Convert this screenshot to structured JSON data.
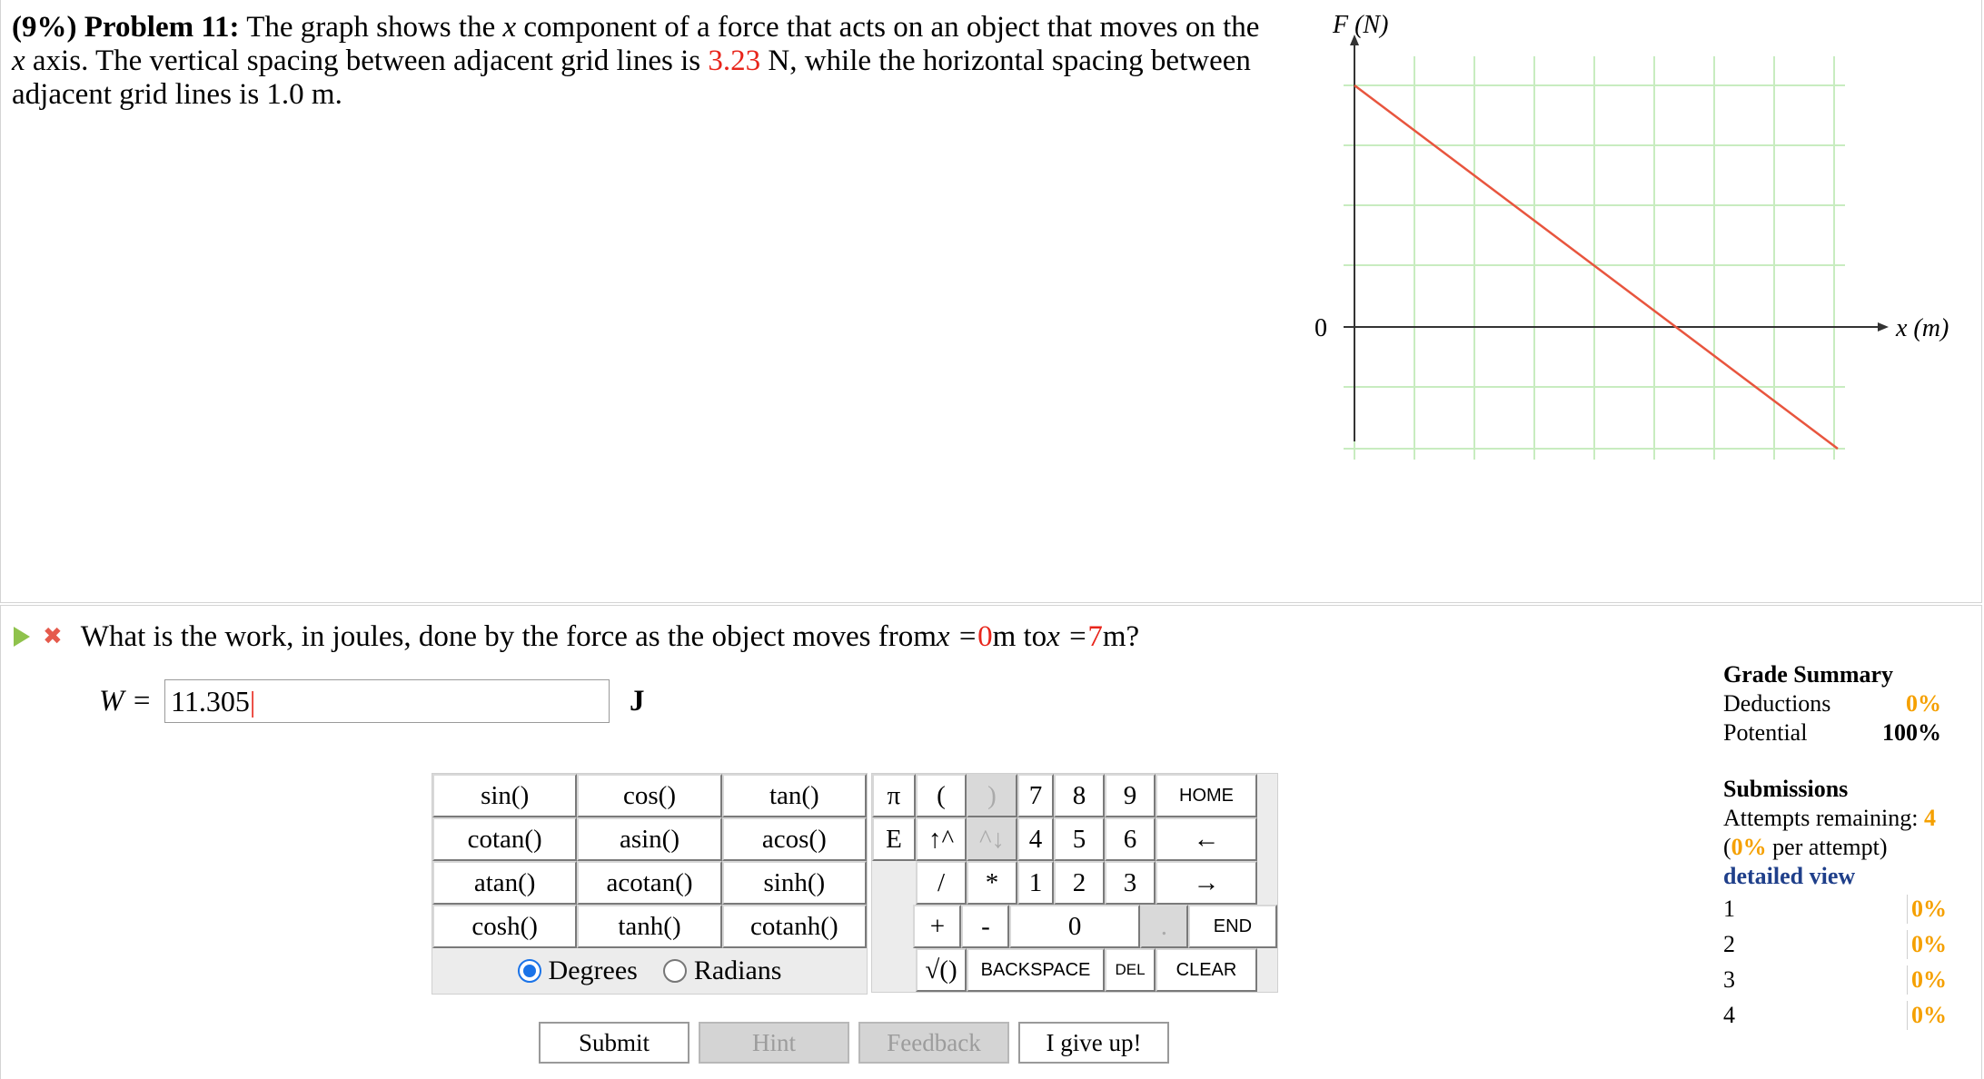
{
  "problem": {
    "weight": "(9%)",
    "label": "Problem 11:",
    "line1_pre": "The graph shows the ",
    "var_x": "x",
    "line1_post": " component of a force that acts on an object that moves on the",
    "line2_pre": " axis. The vertical spacing between adjacent grid lines is ",
    "spacing_value": "3.23",
    "line2_post": " N, while the horizontal spacing between",
    "line3": "adjacent grid lines is 1.0 m."
  },
  "graph": {
    "y_axis_label": "F (N)",
    "x_axis_label": "x (m)",
    "origin_label": "0",
    "line_color": "#e8553e",
    "grid_color": "#c8ecc0"
  },
  "question": {
    "pre": "What is the work, in joules, done by the force as the object moves from ",
    "x_eq": "x = ",
    "x_start": "0",
    "mid": " m to ",
    "x_eq2": "x = ",
    "x_end": "7",
    "post": " m?"
  },
  "answer": {
    "label": "W = ",
    "value": "11.305",
    "unit": "J"
  },
  "func_keys": [
    [
      "sin()",
      "cos()",
      "tan()"
    ],
    [
      "cotan()",
      "asin()",
      "acos()"
    ],
    [
      "atan()",
      "acotan()",
      "sinh()"
    ],
    [
      "cosh()",
      "tanh()",
      "cotanh()"
    ]
  ],
  "angle": {
    "degrees": "Degrees",
    "radians": "Radians"
  },
  "numpad": {
    "pi": "π",
    "lparen": "(",
    "rparen": ")",
    "n7": "7",
    "n8": "8",
    "n9": "9",
    "home": "HOME",
    "e": "E",
    "up": "↑^",
    "down": "^↓",
    "n4": "4",
    "n5": "5",
    "n6": "6",
    "left": "←",
    "slash": "/",
    "star": "*",
    "n1": "1",
    "n2": "2",
    "n3": "3",
    "right": "→",
    "plus": "+",
    "minus": "-",
    "n0": "0",
    "dot": ".",
    "end": "END",
    "sqrt": "√()",
    "backspace": "BACKSPACE",
    "del": "DEL",
    "clear": "CLEAR"
  },
  "actions": {
    "submit": "Submit",
    "hint": "Hint",
    "feedback": "Feedback",
    "give_up": "I give up!"
  },
  "grade_summary": {
    "title": "Grade Summary",
    "deductions_label": "Deductions",
    "deductions_value": "0%",
    "potential_label": "Potential",
    "potential_value": "100%"
  },
  "submissions": {
    "title": "Submissions",
    "attempts_label": "Attempts remaining: ",
    "attempts_value": "4",
    "per_open": "(",
    "per_value": "0%",
    "per_close": " per attempt)",
    "detailed": "detailed view",
    "rows": [
      {
        "n": "1",
        "v": "0%"
      },
      {
        "n": "2",
        "v": "0%"
      },
      {
        "n": "3",
        "v": "0%"
      },
      {
        "n": "4",
        "v": "0%"
      }
    ]
  }
}
